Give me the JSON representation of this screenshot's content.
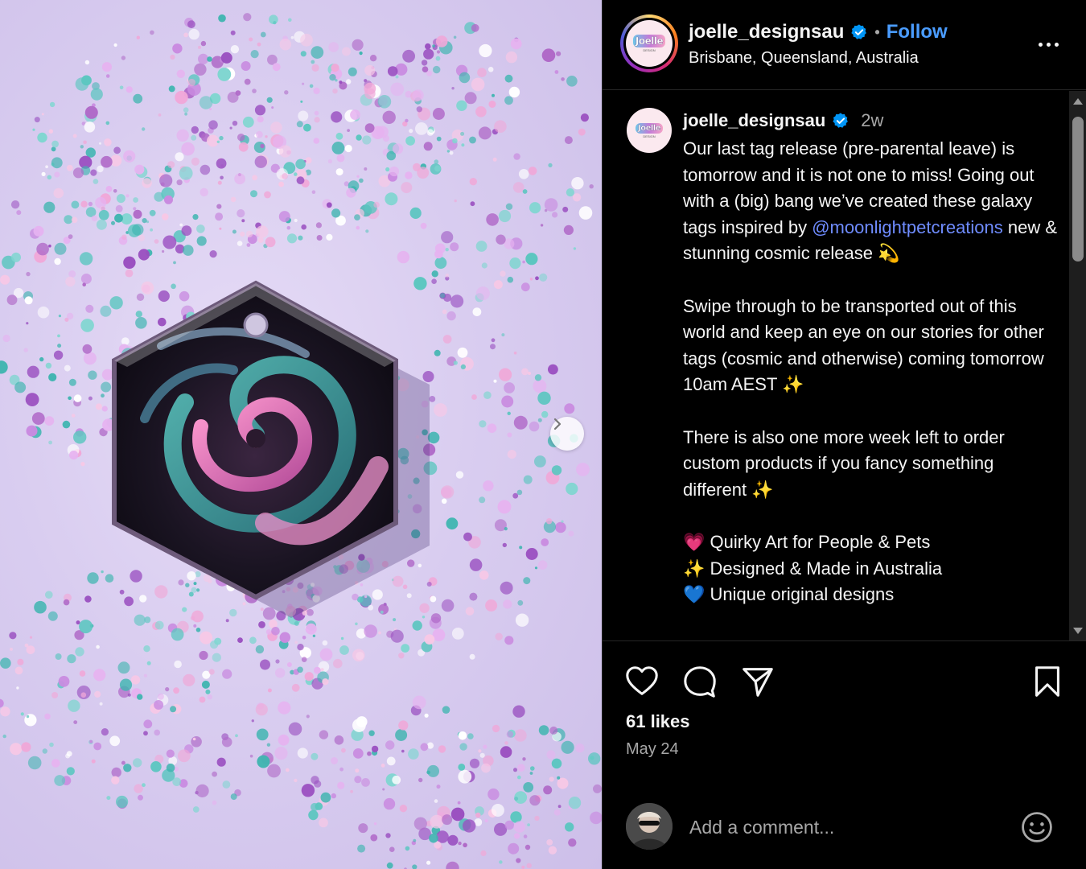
{
  "media": {
    "image_alt": "Hexagonal resin tag with galaxy swirl on glitter background"
  },
  "header": {
    "username": "joelle_designsau",
    "separator": "•",
    "follow_label": "Follow",
    "location": "Brisbane, Queensland, Australia",
    "logo_word": "Joelle",
    "logo_sub": "DESIGN"
  },
  "caption": {
    "username": "joelle_designsau",
    "time_ago": "2w",
    "line_1": "Our last tag release (pre-parental leave) is tomorrow and it is not one to miss! Going out with a (big) bang we’ve created these galaxy tags inspired by ",
    "mention": "@moonlightpetcreations",
    "line_2": " new & stunning cosmic release 💫\n\nSwipe through to be transported out of this world and keep an eye on our stories for other tags (cosmic and otherwise) coming tomorrow 10am AEST ✨\n\nThere is also one more week left to order custom products if you fancy something different ✨\n\n💗 Quirky Art for People & Pets\n✨ Designed & Made in Australia\n💙 Unique original designs"
  },
  "engagement": {
    "likes": "61 likes",
    "date": "May 24"
  },
  "comment": {
    "placeholder": "Add a comment..."
  },
  "icons": {
    "heart": "heart-icon",
    "comment": "comment-icon",
    "share": "share-icon",
    "save": "bookmark-icon",
    "emoji": "emoji-icon",
    "next": "chevron-right-icon",
    "verified": "verified-badge-icon"
  },
  "colors": {
    "background": "#000000",
    "link": "#4a9cff",
    "mention": "#6f8cff",
    "muted": "#a8a8a8"
  }
}
